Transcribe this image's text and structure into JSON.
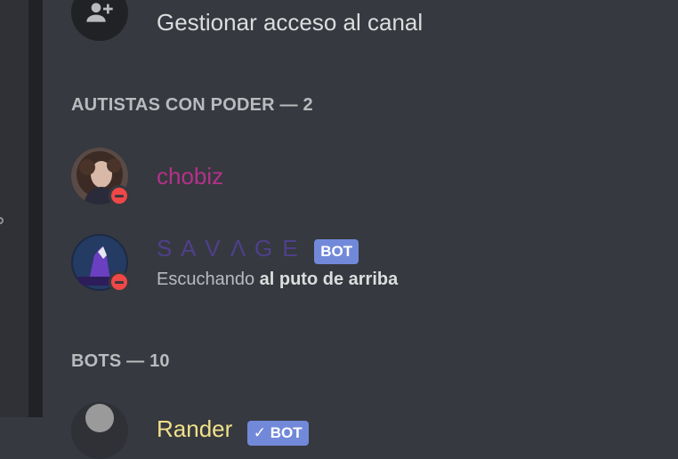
{
  "manage": {
    "label": "Gestionar acceso al canal",
    "icon": "add-user-icon"
  },
  "sections": [
    {
      "title": "AUTISTAS CON PODER — 2",
      "members": [
        {
          "name": "chobiz",
          "name_color": "#b4318b",
          "status": "dnd"
        },
        {
          "name": "S A V Λ G E",
          "name_color": "#4f3f8c",
          "tag": "BOT",
          "status": "dnd",
          "activity_prefix": "Escuchando",
          "activity_bold": "al puto de arriba"
        }
      ]
    },
    {
      "title": "BOTS — 10",
      "members": [
        {
          "name": "Rander",
          "name_color": "#f1e08a",
          "tag": "✓ BOT"
        }
      ]
    }
  ],
  "colors": {
    "background": "#36393f",
    "bot_tag": "#7289da",
    "dnd": "#f04747"
  }
}
